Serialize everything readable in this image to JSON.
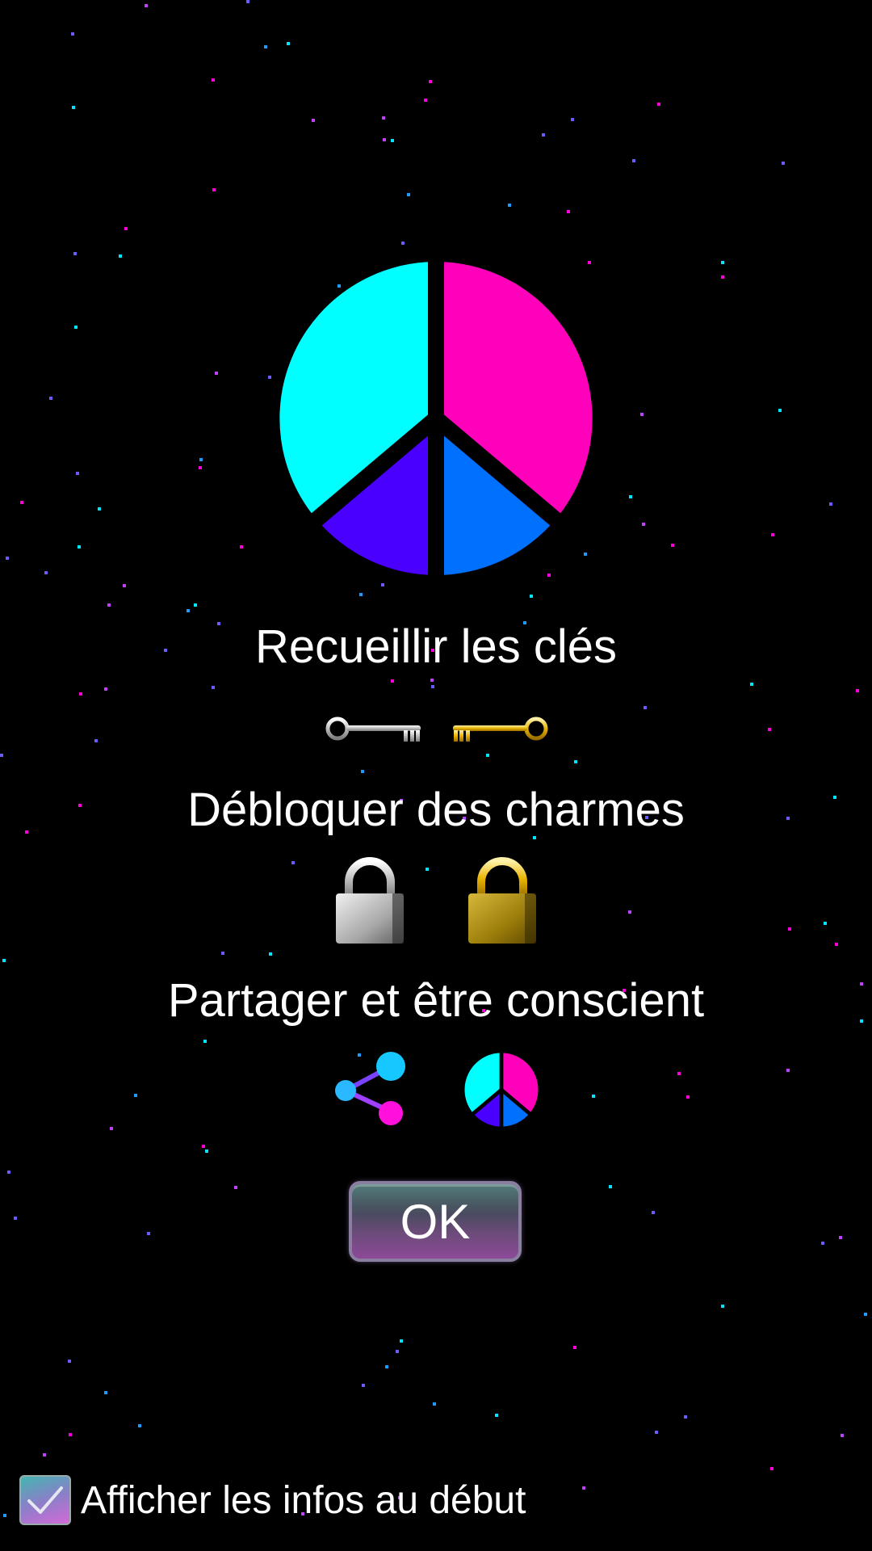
{
  "colors": {
    "cyan": "#00FFFF",
    "magenta": "#FF00BB",
    "violet": "#4A00FF",
    "blue": "#0070FF",
    "gold": "#E8B400",
    "silver": "#C8C8C8"
  },
  "logo": {
    "icon": "peace-sign-icon"
  },
  "sections": {
    "collect_keys": {
      "title": "Recueillir les clés",
      "icons": [
        "silver-key-icon",
        "gold-key-icon"
      ]
    },
    "unlock_charms": {
      "title": "Débloquer des charmes",
      "icons": [
        "silver-padlock-icon",
        "gold-padlock-icon"
      ]
    },
    "share_aware": {
      "title": "Partager et être conscient",
      "icons": [
        "share-icon",
        "peace-sign-icon"
      ]
    }
  },
  "ok_button": {
    "label": "OK"
  },
  "show_info_checkbox": {
    "checked": true,
    "label": "Afficher les infos au début"
  }
}
